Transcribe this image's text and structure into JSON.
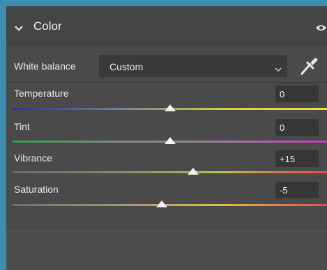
{
  "section": {
    "title": "Color",
    "chevron_icon": "chevron-down-icon",
    "visibility_icon": "eye-icon"
  },
  "white_balance": {
    "label": "White balance",
    "value": "Custom",
    "eyedropper_icon": "eyedropper-icon"
  },
  "sliders": [
    {
      "label": "Temperature",
      "value": "0",
      "level": 0.5,
      "colors": [
        "#2c2f9a",
        "#6f7f9a",
        "#d6d23a",
        "#ece33a"
      ]
    },
    {
      "label": "Tint",
      "value": "0",
      "level": 0.5,
      "colors": [
        "#2fa24a",
        "#7f8d80",
        "#9f7f9a",
        "#c83ac0"
      ]
    },
    {
      "label": "Vibrance",
      "value": "+15",
      "level": 0.575,
      "colors": [
        "#6a6a6a",
        "#8a8a6a",
        "#b9c24a",
        "#e64a4a"
      ]
    },
    {
      "label": "Saturation",
      "value": "-5",
      "level": 0.475,
      "colors": [
        "#6e6e6e",
        "#9a9a72",
        "#e8c03a",
        "#e84a4a"
      ]
    }
  ],
  "colors": {
    "accent": "#3f8cb0",
    "panel": "#4a4a4a",
    "field": "#363636"
  }
}
